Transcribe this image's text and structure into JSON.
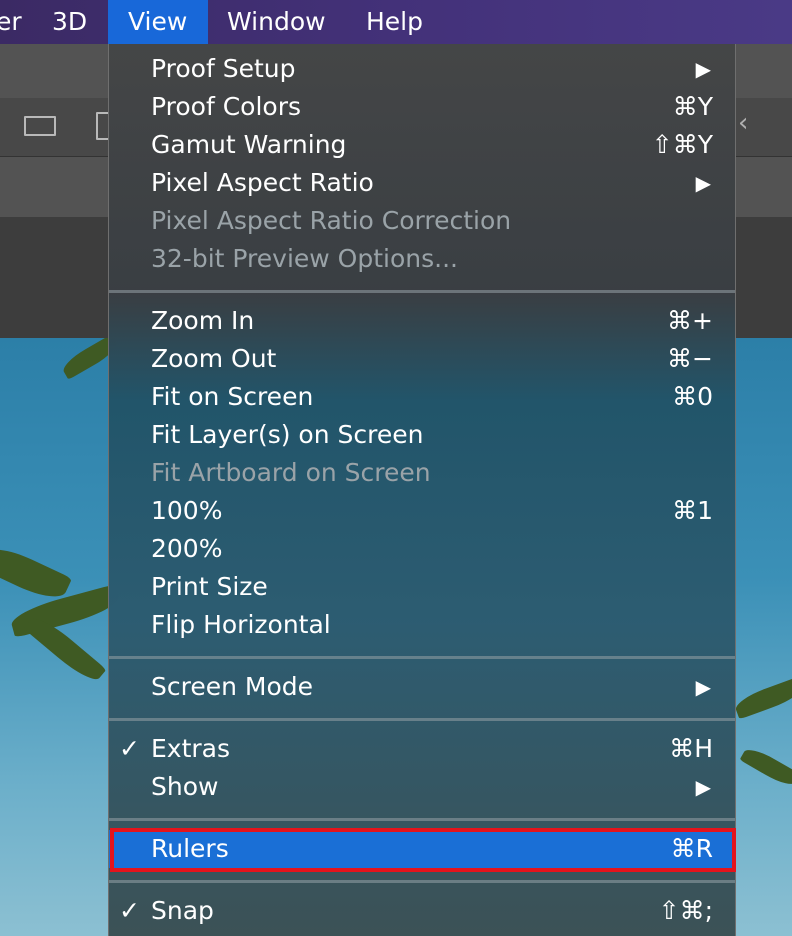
{
  "menubar": {
    "items": [
      {
        "label": "er"
      },
      {
        "label": "3D"
      },
      {
        "label": "View"
      },
      {
        "label": "Window"
      },
      {
        "label": "Help"
      }
    ]
  },
  "view_menu": {
    "proof_setup": {
      "label": "Proof Setup"
    },
    "proof_colors": {
      "label": "Proof Colors",
      "shortcut": "⌘Y"
    },
    "gamut_warning": {
      "label": "Gamut Warning",
      "shortcut": "⇧⌘Y"
    },
    "pixel_aspect_ratio": {
      "label": "Pixel Aspect Ratio"
    },
    "pixel_aspect_ratio_correction": {
      "label": "Pixel Aspect Ratio Correction"
    },
    "preview_options": {
      "label": "32-bit Preview Options..."
    },
    "zoom_in": {
      "label": "Zoom In",
      "shortcut": "⌘+"
    },
    "zoom_out": {
      "label": "Zoom Out",
      "shortcut": "⌘−"
    },
    "fit_on_screen": {
      "label": "Fit on Screen",
      "shortcut": "⌘0"
    },
    "fit_layers_on_screen": {
      "label": "Fit Layer(s) on Screen"
    },
    "fit_artboard_on_screen": {
      "label": "Fit Artboard on Screen"
    },
    "zoom_100": {
      "label": "100%",
      "shortcut": "⌘1"
    },
    "zoom_200": {
      "label": "200%"
    },
    "print_size": {
      "label": "Print Size"
    },
    "flip_horizontal": {
      "label": "Flip Horizontal"
    },
    "screen_mode": {
      "label": "Screen Mode"
    },
    "extras": {
      "label": "Extras",
      "shortcut": "⌘H",
      "check": "✓"
    },
    "show": {
      "label": "Show"
    },
    "rulers": {
      "label": "Rulers",
      "shortcut": "⌘R"
    },
    "snap": {
      "label": "Snap",
      "shortcut": "⇧⌘;",
      "check": "✓"
    }
  },
  "colors": {
    "highlight": "#1a6fd6",
    "annotation_box": "#e4141c"
  }
}
